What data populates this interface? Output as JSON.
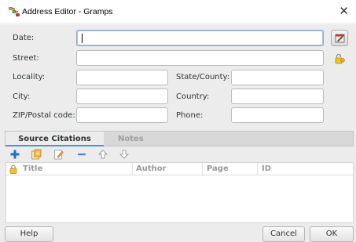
{
  "window": {
    "title": "Address Editor - Gramps",
    "close_glyph": "✕",
    "app_icon": "gramps-tree-icon"
  },
  "form": {
    "date_label": "Date:",
    "date_value": "",
    "street_label": "Street:",
    "street_value": "",
    "locality_label": "Locality:",
    "locality_value": "",
    "state_label": "State/County:",
    "state_value": "",
    "city_label": "City:",
    "city_value": "",
    "country_label": "Country:",
    "country_value": "",
    "zip_label": "ZIP/Postal code:",
    "zip_value": "",
    "phone_label": "Phone:",
    "phone_value": ""
  },
  "icons": {
    "date_editor": "date-editor-icon",
    "privacy": "privacy-lock-icon",
    "toolbar": [
      "add-icon",
      "share-existing-icon",
      "edit-icon",
      "remove-icon",
      "move-up-icon",
      "move-down-icon"
    ]
  },
  "tabs": [
    {
      "label": "Source Citations",
      "active": true
    },
    {
      "label": "Notes",
      "active": false
    }
  ],
  "table": {
    "columns": [
      "Title",
      "Author",
      "Page",
      "ID"
    ],
    "rows": []
  },
  "buttons": {
    "help": "Help",
    "cancel": "Cancel",
    "ok": "OK"
  },
  "colors": {
    "accent_tab_underline": "#4a90d9",
    "add_icon": "#2a6cc4",
    "lock_icon": "#e0a800"
  }
}
